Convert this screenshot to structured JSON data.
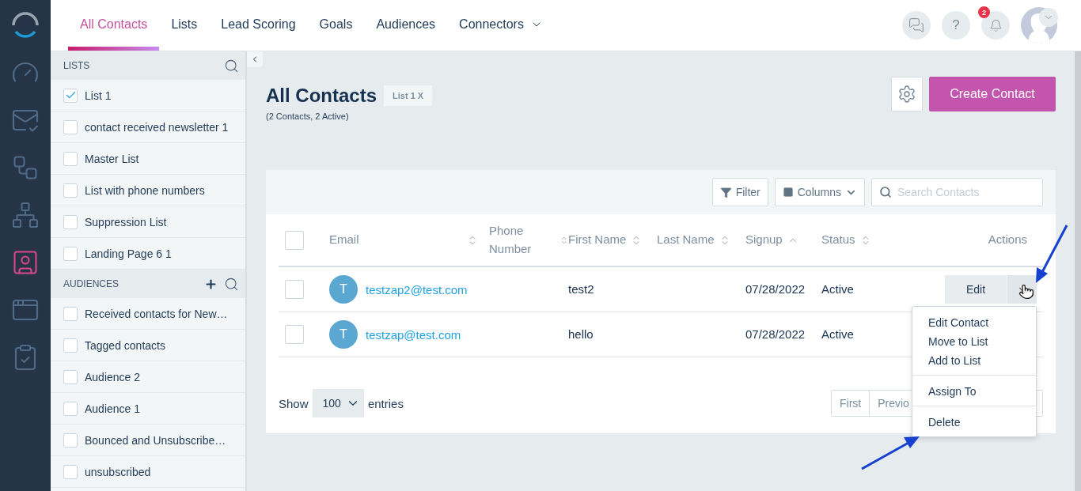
{
  "nav": [
    {
      "kind": "dashboard",
      "selected": false
    },
    {
      "kind": "mail",
      "selected": false
    },
    {
      "kind": "flow",
      "selected": false
    },
    {
      "kind": "network",
      "selected": false
    },
    {
      "kind": "contacts",
      "selected": true
    },
    {
      "kind": "landing",
      "selected": false
    },
    {
      "kind": "forms",
      "selected": false
    }
  ],
  "tabs": [
    {
      "label": "All Contacts",
      "selected": true
    },
    {
      "label": "Lists",
      "selected": false
    },
    {
      "label": "Lead Scoring",
      "selected": false
    },
    {
      "label": "Goals",
      "selected": false
    },
    {
      "label": "Audiences",
      "selected": false
    },
    {
      "label": "Connectors",
      "selected": false,
      "has_menu": true
    }
  ],
  "header_actions": {
    "help": "?",
    "notifications": "2"
  },
  "sidebar": {
    "sections": [
      {
        "title": "LISTS",
        "can_add": false,
        "items": [
          {
            "label": "List 1",
            "checked": true
          },
          {
            "label": "contact received newsletter 1",
            "checked": false
          },
          {
            "label": "Master List",
            "checked": false
          },
          {
            "label": "List with phone numbers",
            "checked": false
          },
          {
            "label": "Suppression List",
            "checked": false
          },
          {
            "label": "Landing Page 6 1",
            "checked": false
          }
        ]
      },
      {
        "title": "AUDIENCES",
        "can_add": true,
        "items": [
          {
            "label": "Received contacts for New…",
            "checked": false
          },
          {
            "label": "Tagged contacts",
            "checked": false
          },
          {
            "label": "Audience 2",
            "checked": false
          },
          {
            "label": "Audience 1",
            "checked": false
          },
          {
            "label": "Bounced and Unsubscribe…",
            "checked": false
          },
          {
            "label": "unsubscribed",
            "checked": false
          }
        ]
      }
    ]
  },
  "page": {
    "title": "All Contacts",
    "filter_tag": "List 1 X",
    "subtitle": "(2 Contacts, 2 Active)",
    "create_button": "Create Contact"
  },
  "toolbar": {
    "filter": "Filter",
    "columns": "Columns",
    "search_placeholder": "Search Contacts"
  },
  "table": {
    "all_checked": false,
    "columns": [
      {
        "label": "Email",
        "sortable": true,
        "sorted": false
      },
      {
        "label": "Phone Number",
        "sortable": true,
        "sorted": false
      },
      {
        "label": "First Name",
        "sortable": true,
        "sorted": false
      },
      {
        "label": "Last Name",
        "sortable": true,
        "sorted": false
      },
      {
        "label": "Signup",
        "sortable": true,
        "sorted": true
      },
      {
        "label": "Status",
        "sortable": true,
        "sorted": false
      },
      {
        "label": "Actions",
        "sortable": false
      }
    ],
    "rows": [
      {
        "checked": false,
        "avatar": "T",
        "email": "testzap2@test.com",
        "first_name": "test2",
        "signup": "07/28/2022",
        "status": "Active",
        "action": "Edit",
        "menu_open": true
      },
      {
        "checked": false,
        "avatar": "T",
        "email": "testzap@test.com",
        "first_name": "hello",
        "signup": "07/28/2022",
        "status": "Active"
      }
    ]
  },
  "action_menu": [
    {
      "items": [
        "Edit Contact",
        "Move to List",
        "Add to List"
      ]
    },
    {
      "items": [
        "Assign To"
      ]
    },
    {
      "items": [
        "Delete"
      ]
    }
  ],
  "footer": {
    "show": "Show",
    "page_size": "100",
    "entries": "entries",
    "pagination": [
      "First",
      "Previo"
    ]
  }
}
